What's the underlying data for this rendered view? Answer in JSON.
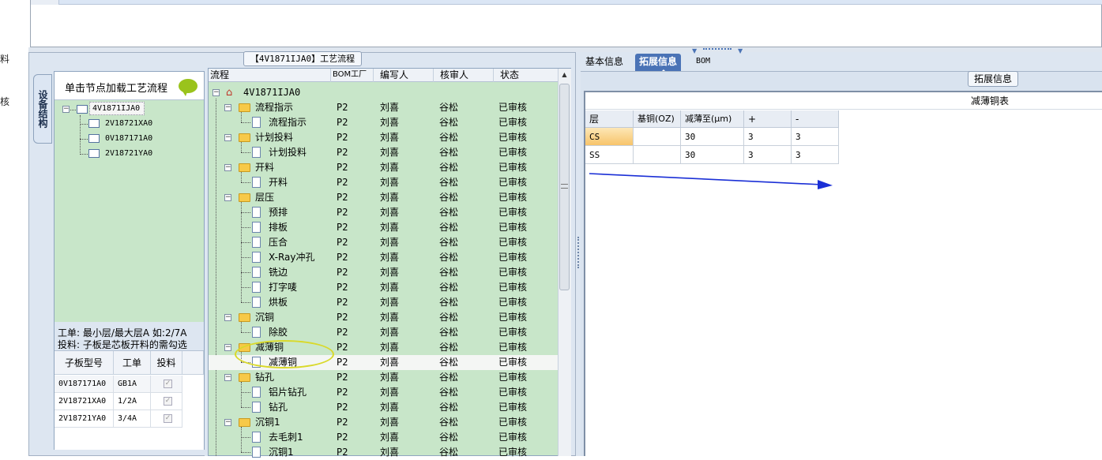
{
  "left_edge": {
    "labels": [
      "料",
      "核"
    ]
  },
  "process_tab_title": "【4V1871IJA0】工艺流程",
  "side_tab": "设备结构",
  "structure": {
    "header": "单击节点加载工艺流程",
    "root": "4V1871IJA0",
    "children": [
      "2V18721XA0",
      "0V187171A0",
      "2V18721YA0"
    ]
  },
  "notes": {
    "line1": "工单: 最小层/最大层A 如:2/7A",
    "line2": "投料: 子板是芯板开料的需勾选"
  },
  "sub_table": {
    "headers": [
      "子板型号",
      "工单",
      "投料"
    ],
    "rows": [
      {
        "model": "0V187171A0",
        "order": "GB1A",
        "checked": true
      },
      {
        "model": "2V18721XA0",
        "order": "1/2A",
        "checked": true
      },
      {
        "model": "2V18721YA0",
        "order": "3/4A",
        "checked": true
      }
    ]
  },
  "flow_table": {
    "headers": [
      "流程",
      "BOM工厂",
      "编写人",
      "核审人",
      "状态"
    ],
    "root": "4V1871IJA0",
    "rows": [
      {
        "name": "流程指示",
        "type": "folder",
        "factory": "P2",
        "writer": "刘喜",
        "reviewer": "谷松",
        "status": "已审核"
      },
      {
        "name": "流程指示",
        "type": "doc",
        "factory": "P2",
        "writer": "刘喜",
        "reviewer": "谷松",
        "status": "已审核"
      },
      {
        "name": "计划投料",
        "type": "folder",
        "factory": "P2",
        "writer": "刘喜",
        "reviewer": "谷松",
        "status": "已审核"
      },
      {
        "name": "计划投料",
        "type": "doc",
        "factory": "P2",
        "writer": "刘喜",
        "reviewer": "谷松",
        "status": "已审核"
      },
      {
        "name": "开料",
        "type": "folder",
        "factory": "P2",
        "writer": "刘喜",
        "reviewer": "谷松",
        "status": "已审核"
      },
      {
        "name": "开料",
        "type": "doc",
        "factory": "P2",
        "writer": "刘喜",
        "reviewer": "谷松",
        "status": "已审核"
      },
      {
        "name": "层压",
        "type": "folder",
        "factory": "P2",
        "writer": "刘喜",
        "reviewer": "谷松",
        "status": "已审核"
      },
      {
        "name": "预排",
        "type": "doc",
        "factory": "P2",
        "writer": "刘喜",
        "reviewer": "谷松",
        "status": "已审核"
      },
      {
        "name": "排板",
        "type": "doc",
        "factory": "P2",
        "writer": "刘喜",
        "reviewer": "谷松",
        "status": "已审核"
      },
      {
        "name": "压合",
        "type": "doc",
        "factory": "P2",
        "writer": "刘喜",
        "reviewer": "谷松",
        "status": "已审核"
      },
      {
        "name": "X-Ray冲孔",
        "type": "doc",
        "factory": "P2",
        "writer": "刘喜",
        "reviewer": "谷松",
        "status": "已审核"
      },
      {
        "name": "铣边",
        "type": "doc",
        "factory": "P2",
        "writer": "刘喜",
        "reviewer": "谷松",
        "status": "已审核"
      },
      {
        "name": "打字唛",
        "type": "doc",
        "factory": "P2",
        "writer": "刘喜",
        "reviewer": "谷松",
        "status": "已审核"
      },
      {
        "name": "烘板",
        "type": "doc",
        "factory": "P2",
        "writer": "刘喜",
        "reviewer": "谷松",
        "status": "已审核"
      },
      {
        "name": "沉铜",
        "type": "folder",
        "factory": "P2",
        "writer": "刘喜",
        "reviewer": "谷松",
        "status": "已审核"
      },
      {
        "name": "除胶",
        "type": "doc",
        "factory": "P2",
        "writer": "刘喜",
        "reviewer": "谷松",
        "status": "已审核"
      },
      {
        "name": "减薄铜",
        "type": "folder",
        "factory": "P2",
        "writer": "刘喜",
        "reviewer": "谷松",
        "status": "已审核"
      },
      {
        "name": "减薄铜",
        "type": "doc",
        "factory": "P2",
        "writer": "刘喜",
        "reviewer": "谷松",
        "status": "已审核"
      },
      {
        "name": "钻孔",
        "type": "folder",
        "factory": "P2",
        "writer": "刘喜",
        "reviewer": "谷松",
        "status": "已审核"
      },
      {
        "name": "铝片钻孔",
        "type": "doc",
        "factory": "P2",
        "writer": "刘喜",
        "reviewer": "谷松",
        "status": "已审核"
      },
      {
        "name": "钻孔",
        "type": "doc",
        "factory": "P2",
        "writer": "刘喜",
        "reviewer": "谷松",
        "status": "已审核"
      },
      {
        "name": "沉铜1",
        "type": "folder",
        "factory": "P2",
        "writer": "刘喜",
        "reviewer": "谷松",
        "status": "已审核"
      },
      {
        "name": "去毛刺1",
        "type": "doc",
        "factory": "P2",
        "writer": "刘喜",
        "reviewer": "谷松",
        "status": "已审核"
      },
      {
        "name": "沉铜1",
        "type": "doc",
        "factory": "P2",
        "writer": "刘喜",
        "reviewer": "谷松",
        "status": "已审核"
      }
    ]
  },
  "right_tabs": [
    "基本信息",
    "拓展信息",
    "BOM"
  ],
  "ext_panel_title": "拓展信息",
  "grid": {
    "caption": "减薄铜表",
    "headers": [
      "层",
      "基铜(OZ)",
      "减薄至(μm)",
      "+",
      "-"
    ],
    "rows": [
      [
        "CS",
        "",
        "30",
        "3",
        "3"
      ],
      [
        "SS",
        "",
        "30",
        "3",
        "3"
      ]
    ]
  },
  "colors": {
    "panel_green": "#c8e6c9",
    "active_tab": "#4a73b6",
    "annotation_arrow": "#1a2fd6",
    "annotation_ellipse": "#d9d92a"
  }
}
